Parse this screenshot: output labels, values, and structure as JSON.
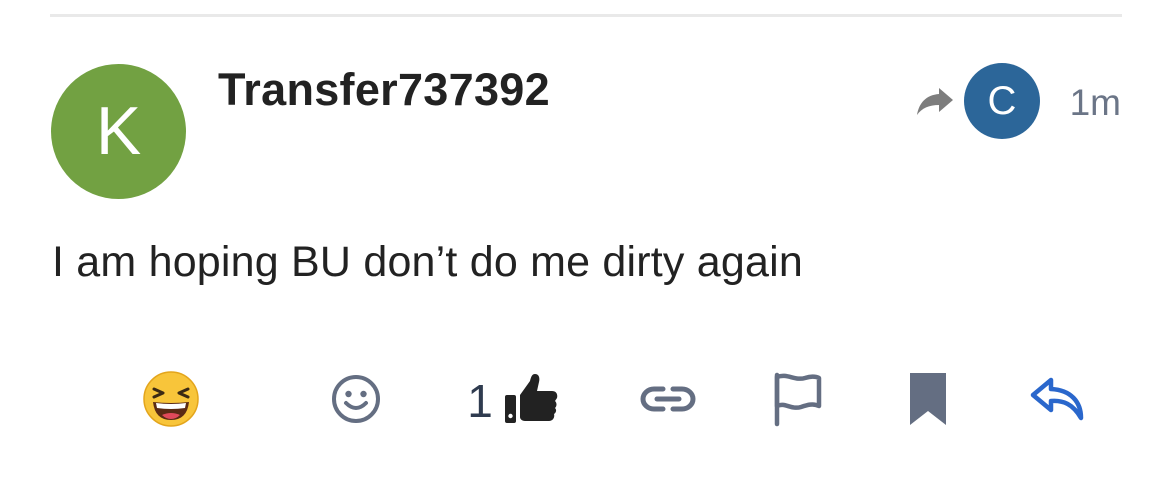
{
  "colors": {
    "avatar_bg": "#72a142",
    "reply_avatar_bg": "#2c6699",
    "icon": "#646e82",
    "reply_icon": "#2a67cc",
    "liked": "#222222",
    "divider": "#e9e9e9"
  },
  "post": {
    "author_avatar_letter": "K",
    "username": "Transfer737392",
    "reply_to_avatar_letter": "C",
    "reply_to_icon": "share-arrow-icon",
    "date": "1m",
    "body": "I am hoping BU don’t do me dirty again"
  },
  "actions": {
    "reaction_emoji": "😆",
    "like_count": "1",
    "icons": [
      "laughing-emoji",
      "emoji-picker-icon",
      "thumbs-up-icon",
      "link-icon",
      "flag-icon",
      "bookmark-icon",
      "reply-icon"
    ]
  }
}
